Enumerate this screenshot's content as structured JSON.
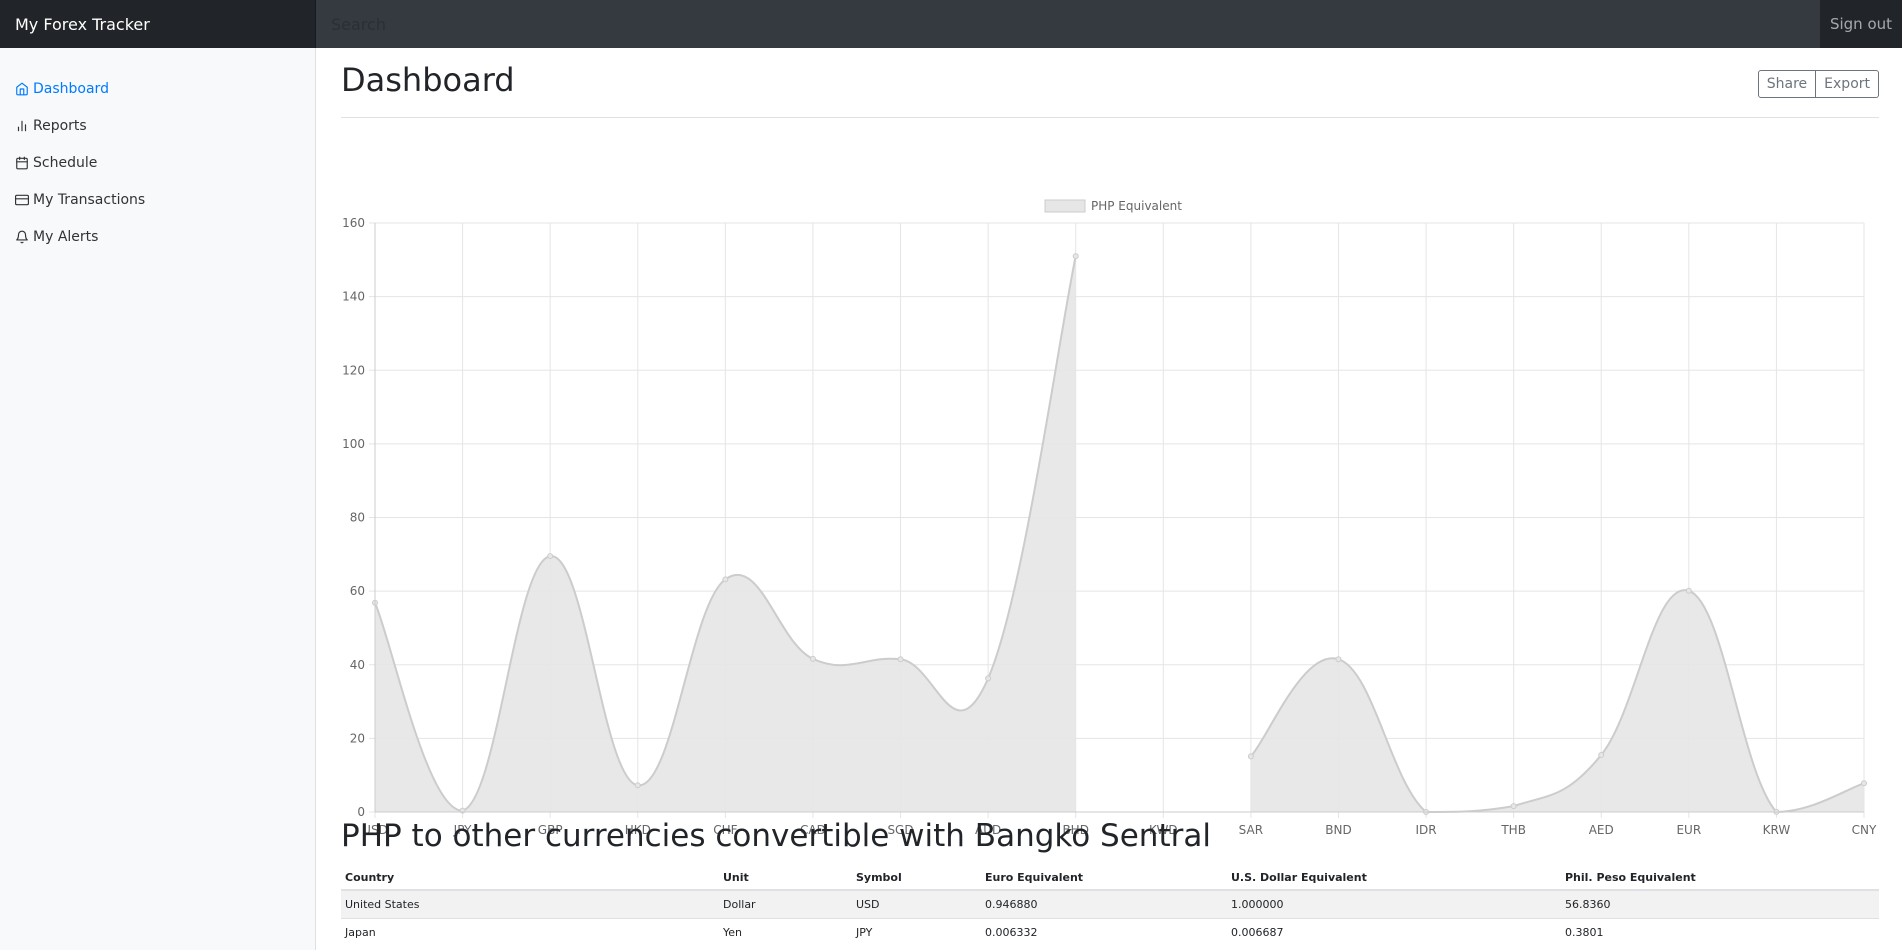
{
  "navbar": {
    "brand": "My Forex Tracker",
    "search_placeholder": "Search",
    "signout": "Sign out"
  },
  "sidebar": {
    "items": [
      {
        "label": "Dashboard",
        "icon": "home-icon",
        "active": true
      },
      {
        "label": "Reports",
        "icon": "bar-chart-icon"
      },
      {
        "label": "Schedule",
        "icon": "calendar-icon"
      },
      {
        "label": "My Transactions",
        "icon": "credit-card-icon"
      },
      {
        "label": "My Alerts",
        "icon": "bell-icon"
      }
    ]
  },
  "header": {
    "title": "Dashboard",
    "share_label": "Share",
    "export_label": "Export"
  },
  "chart_data": {
    "type": "line",
    "categories": [
      "USD",
      "JPY",
      "GBP",
      "HKD",
      "CHF",
      "CAD",
      "SGD",
      "AUD",
      "BHD",
      "KWD",
      "SAR",
      "BND",
      "IDR",
      "THB",
      "AED",
      "EUR",
      "KRW",
      "CNY"
    ],
    "series": [
      {
        "name": "PHP Equivalent",
        "values": [
          56.836,
          0.3801,
          69.5,
          7.25,
          63.2,
          41.6,
          41.5,
          36.3,
          151,
          null,
          15.1,
          41.5,
          0.004,
          1.6,
          15.5,
          60.1,
          0.043,
          7.8
        ]
      }
    ],
    "ylim": [
      0,
      160
    ],
    "yticks": [
      0,
      20,
      40,
      60,
      80,
      100,
      120,
      140,
      160
    ],
    "grid": true,
    "legend": "top-center",
    "fill_color": "#e6e6e6",
    "line_color": "#cccccc"
  },
  "table": {
    "title": "PHP to other currencies convertible with Bangko Sentral",
    "columns": [
      "Country",
      "Unit",
      "Symbol",
      "Euro Equivalent",
      "U.S. Dollar Equivalent",
      "Phil. Peso Equivalent"
    ],
    "rows": [
      [
        "United States",
        "Dollar",
        "USD",
        "0.946880",
        "1.000000",
        "56.8360"
      ],
      [
        "Japan",
        "Yen",
        "JPY",
        "0.006332",
        "0.006687",
        "0.3801"
      ]
    ]
  }
}
